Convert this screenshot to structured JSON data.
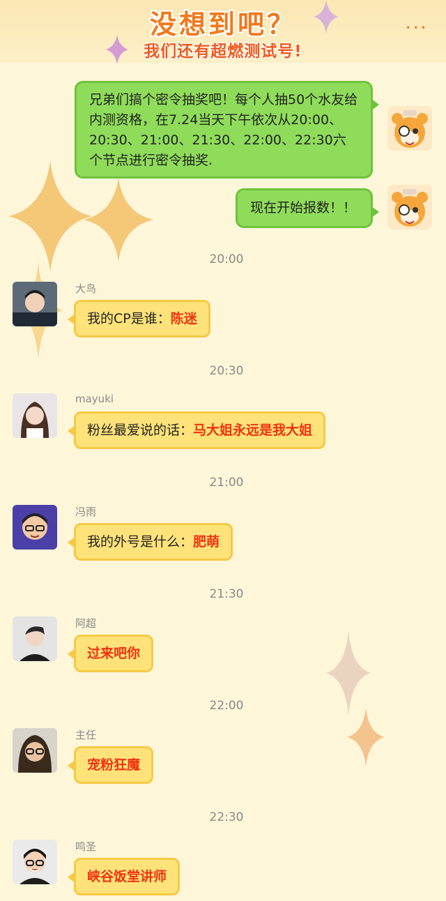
{
  "header": {
    "title": "没想到吧？",
    "subtitle": "我们还有超燃测试号!",
    "more_icon": "more-dots-icon"
  },
  "host_messages": [
    {
      "text": "兄弟们搞个密令抽奖吧！每个人抽50个水友给内测资格，在7.24当天下午依次从20:00、20:30、21:00、21:30、22:00、22:30六个节点进行密令抽奖."
    },
    {
      "text": "现在开始报数！！"
    }
  ],
  "chat": [
    {
      "time": "20:00",
      "name": "大鸟",
      "prefix": "我的CP是谁：",
      "highlight": "陈迷"
    },
    {
      "time": "20:30",
      "name": "mayuki",
      "prefix": "粉丝最爱说的话：",
      "highlight": "马大姐永远是我大姐"
    },
    {
      "time": "21:00",
      "name": "冯雨",
      "prefix": "我的外号是什么：",
      "highlight": "肥萌"
    },
    {
      "time": "21:30",
      "name": "阿超",
      "prefix": "",
      "highlight": "过来吧你"
    },
    {
      "time": "22:00",
      "name": "主任",
      "prefix": "",
      "highlight": "宠粉狂魔"
    },
    {
      "time": "22:30",
      "name": "鸣圣",
      "prefix": "",
      "highlight": "峡谷饭堂讲师"
    }
  ],
  "colors": {
    "background": "#fdf6d9",
    "green_bubble": "#8fdc5a",
    "yellow_bubble": "#ffe37a",
    "highlight_text": "#f0320f",
    "title_orange": "#f07a1c"
  }
}
